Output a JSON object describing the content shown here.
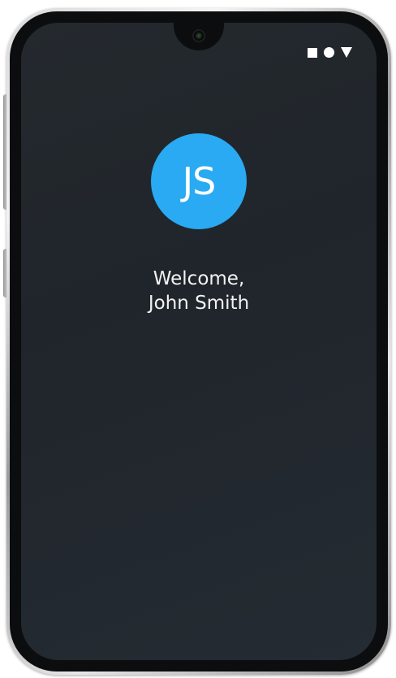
{
  "status_bar": {
    "icons": [
      "square-icon",
      "circle-icon",
      "triangle-icon"
    ]
  },
  "profile": {
    "initials": "JS",
    "avatar_color": "#29aaf2",
    "greeting": "Welcome,",
    "name": "John Smith"
  },
  "colors": {
    "screen_background": "#22282e",
    "text": "#f2f2f2"
  }
}
